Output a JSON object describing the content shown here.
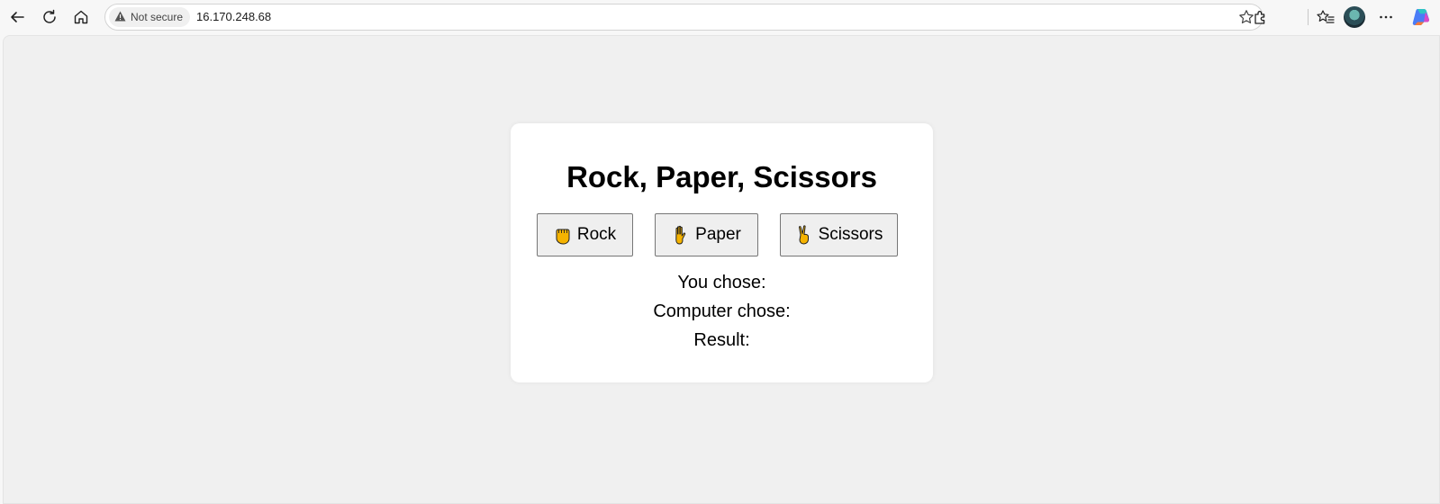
{
  "browser": {
    "security_label": "Not secure",
    "url": "16.170.248.68",
    "icons": [
      "back-icon",
      "refresh-icon",
      "home-icon",
      "warning-icon",
      "favorite-star-icon",
      "extensions-icon",
      "favorites-icon",
      "profile-avatar",
      "more-icon",
      "copilot-icon"
    ]
  },
  "page": {
    "title": "Rock, Paper, Scissors",
    "buttons": {
      "rock": {
        "label": "Rock",
        "icon": "fist-icon"
      },
      "paper": {
        "label": "Paper",
        "icon": "raised-hand-icon"
      },
      "scissors": {
        "label": "Scissors",
        "icon": "victory-hand-icon"
      }
    },
    "results": {
      "you_chose_label": "You chose:",
      "computer_chose_label": "Computer chose:",
      "result_label": "Result:"
    }
  },
  "colors": {
    "page_background": "#f0f0f0",
    "card_background": "#ffffff",
    "button_background": "#efefef",
    "emoji_fill": "#f5b300"
  }
}
